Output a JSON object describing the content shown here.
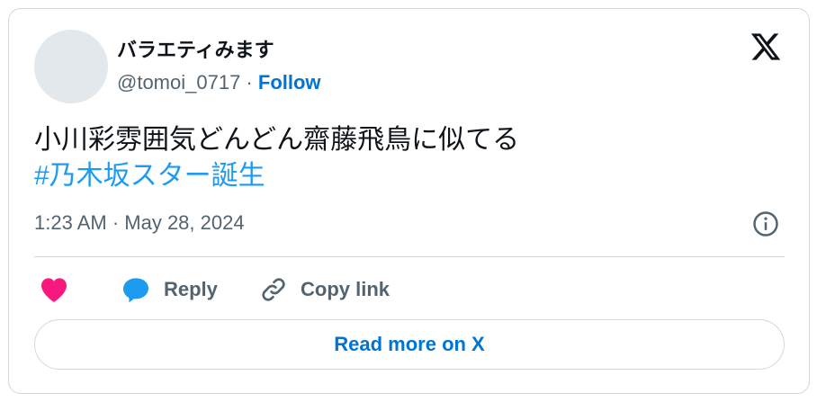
{
  "author": {
    "display_name": "バラエティみます",
    "handle": "@tomoi_0717",
    "separator": " · ",
    "follow_label": "Follow"
  },
  "tweet": {
    "text": "小川彩雰囲気どんどん齋藤飛鳥に似てる",
    "hashtag": "#乃木坂スター誕生",
    "timestamp": "1:23 AM · May 28, 2024"
  },
  "actions": {
    "reply_label": "Reply",
    "copy_link_label": "Copy link"
  },
  "read_more_label": "Read more on X",
  "colors": {
    "link_blue": "#0074d4",
    "hashtag_blue": "#1d9bf0",
    "like_pink": "#f91880",
    "reply_blue": "#1d9bf0",
    "muted_gray": "#536471",
    "border": "#cfd9de"
  }
}
